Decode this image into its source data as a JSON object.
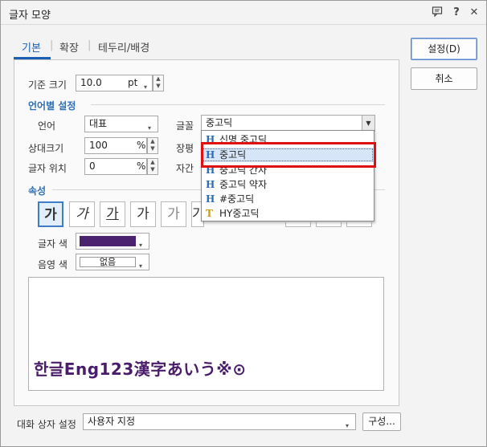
{
  "window": {
    "title": "글자 모양"
  },
  "tabs": [
    {
      "label": "기본"
    },
    {
      "label": "확장"
    },
    {
      "label": "테두리/배경"
    }
  ],
  "base_size": {
    "label": "기준 크기",
    "value": "10.0",
    "unit": "pt"
  },
  "lang_section": {
    "title": "언어별 설정"
  },
  "language": {
    "label": "언어",
    "value": "대표"
  },
  "font": {
    "label": "글꼴",
    "value": "중고딕"
  },
  "relative_size": {
    "label": "상대크기",
    "value": "100",
    "unit": "%"
  },
  "char_pos": {
    "label": "글자 위치",
    "value": "0",
    "unit": "%"
  },
  "ratio": {
    "label": "장평"
  },
  "spacing": {
    "label": "자간"
  },
  "font_list": [
    {
      "label": "신명 중고딕",
      "icon": "H"
    },
    {
      "label": "중고딕",
      "icon": "H"
    },
    {
      "label": "중고딕 간자",
      "icon": "H"
    },
    {
      "label": "중고딕 약자",
      "icon": "H"
    },
    {
      "label": "#중고딕",
      "icon": "H"
    },
    {
      "label": "HY중고딕",
      "icon": "T"
    }
  ],
  "attr_section": {
    "title": "속성"
  },
  "attr_buttons": [
    "가",
    "가",
    "가",
    "가",
    "가",
    "가"
  ],
  "text_color": {
    "label": "글자 색",
    "color": "#4b2270"
  },
  "shade_color": {
    "label": "음영 색",
    "value": "없음"
  },
  "preview": {
    "text": "한글Eng123漢字あいう※⊙"
  },
  "buttons": {
    "ok": "설정(D)",
    "cancel": "취소",
    "config": "구성..."
  },
  "dialog_setting": {
    "label": "대화 상자 설정",
    "value": "사용자 지정"
  }
}
